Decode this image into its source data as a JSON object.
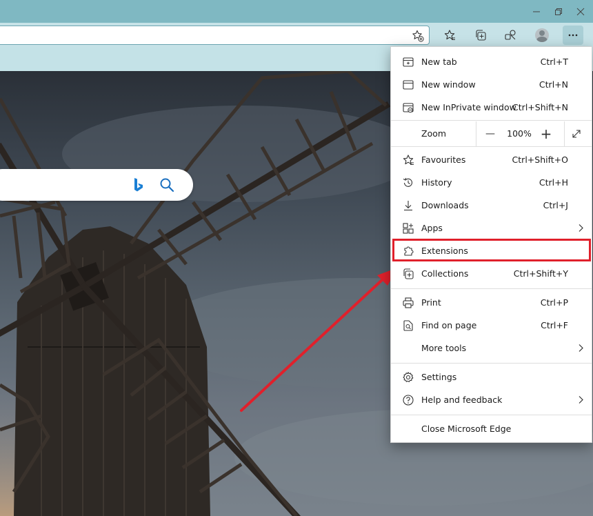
{
  "menu": {
    "items": [
      {
        "label": "New tab",
        "shortcut": "Ctrl+T"
      },
      {
        "label": "New window",
        "shortcut": "Ctrl+N"
      },
      {
        "label": "New InPrivate window",
        "shortcut": "Ctrl+Shift+N"
      },
      {
        "label": "Favourites",
        "shortcut": "Ctrl+Shift+O"
      },
      {
        "label": "History",
        "shortcut": "Ctrl+H"
      },
      {
        "label": "Downloads",
        "shortcut": "Ctrl+J"
      },
      {
        "label": "Apps",
        "shortcut": ""
      },
      {
        "label": "Extensions",
        "shortcut": ""
      },
      {
        "label": "Collections",
        "shortcut": "Ctrl+Shift+Y"
      },
      {
        "label": "Print",
        "shortcut": "Ctrl+P"
      },
      {
        "label": "Find on page",
        "shortcut": "Ctrl+F"
      },
      {
        "label": "More tools",
        "shortcut": ""
      },
      {
        "label": "Settings",
        "shortcut": ""
      },
      {
        "label": "Help and feedback",
        "shortcut": ""
      },
      {
        "label": "Close Microsoft Edge",
        "shortcut": ""
      }
    ],
    "zoom": {
      "label": "Zoom",
      "value": "100%",
      "minus": "—",
      "plus": "+"
    }
  },
  "colors": {
    "titlebar": "#7fb8c2",
    "toolbar": "#c6e2e7",
    "highlight": "#e0202b",
    "bing_blue": "#1a7fd4"
  }
}
